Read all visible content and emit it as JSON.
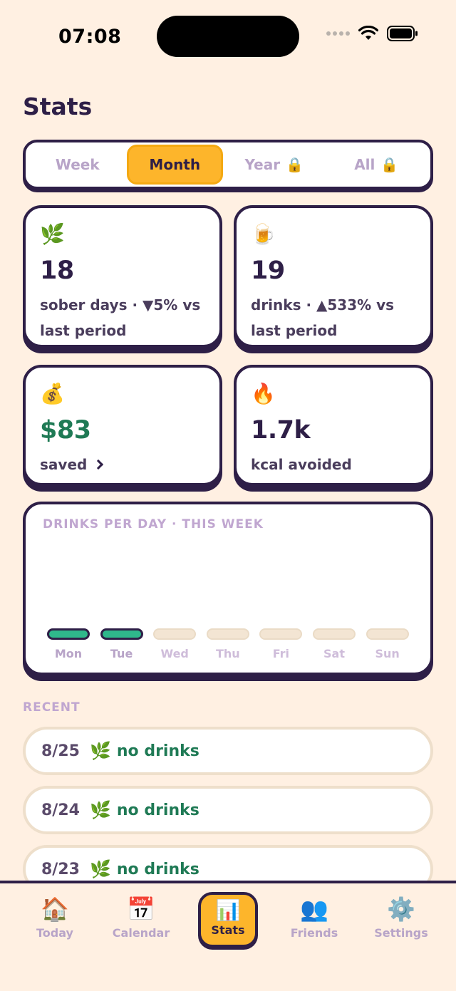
{
  "status_bar": {
    "time": "07:08"
  },
  "title": "Stats",
  "segments": [
    {
      "label": "Week",
      "active": false,
      "locked": false
    },
    {
      "label": "Month",
      "active": true,
      "locked": false
    },
    {
      "label": "Year",
      "active": false,
      "locked": true
    },
    {
      "label": "All",
      "active": false,
      "locked": true
    }
  ],
  "lock_glyph": "🔒",
  "cards": {
    "sober": {
      "emoji": "🌿",
      "value": "18",
      "desc_line1": "sober days · ▼5% vs",
      "desc_line2": "last period"
    },
    "drinks": {
      "emoji": "🍺",
      "value": "19",
      "desc_line1": "drinks · ▲533% vs",
      "desc_line2": "last period"
    },
    "saved": {
      "emoji": "💰",
      "value": "$83",
      "desc": "saved"
    },
    "kcal": {
      "emoji": "🔥",
      "value": "1.7k",
      "desc": "kcal avoided"
    }
  },
  "chart": {
    "title": "DRINKS PER DAY · THIS WEEK"
  },
  "chart_data": {
    "type": "bar",
    "categories": [
      "Mon",
      "Tue",
      "Wed",
      "Thu",
      "Fri",
      "Sat",
      "Sun"
    ],
    "logged": [
      true,
      true,
      false,
      false,
      false,
      false,
      false
    ],
    "values": [
      0,
      0,
      0,
      0,
      0,
      0,
      0
    ]
  },
  "recent": {
    "label": "RECENT",
    "items": [
      {
        "date": "8/25",
        "emoji": "🌿",
        "status": "no drinks"
      },
      {
        "date": "8/24",
        "emoji": "🌿",
        "status": "no drinks"
      },
      {
        "date": "8/23",
        "emoji": "🌿",
        "status": "no drinks"
      }
    ]
  },
  "nav": [
    {
      "id": "today",
      "icon": "🏠",
      "label": "Today",
      "active": false
    },
    {
      "id": "calendar",
      "icon": "📅",
      "label": "Calendar",
      "active": false
    },
    {
      "id": "stats",
      "icon": "📊",
      "label": "Stats",
      "active": true
    },
    {
      "id": "friends",
      "icon": "👥",
      "label": "Friends",
      "active": false
    },
    {
      "id": "settings",
      "icon": "⚙️",
      "label": "Settings",
      "active": false
    }
  ],
  "colors": {
    "background": "#FFF0E2",
    "ink": "#2E1F47",
    "accent": "#FDB52B",
    "green": "#1F7A55",
    "bar_fill": "#2FB88B",
    "muted": "#B8A4C8"
  }
}
